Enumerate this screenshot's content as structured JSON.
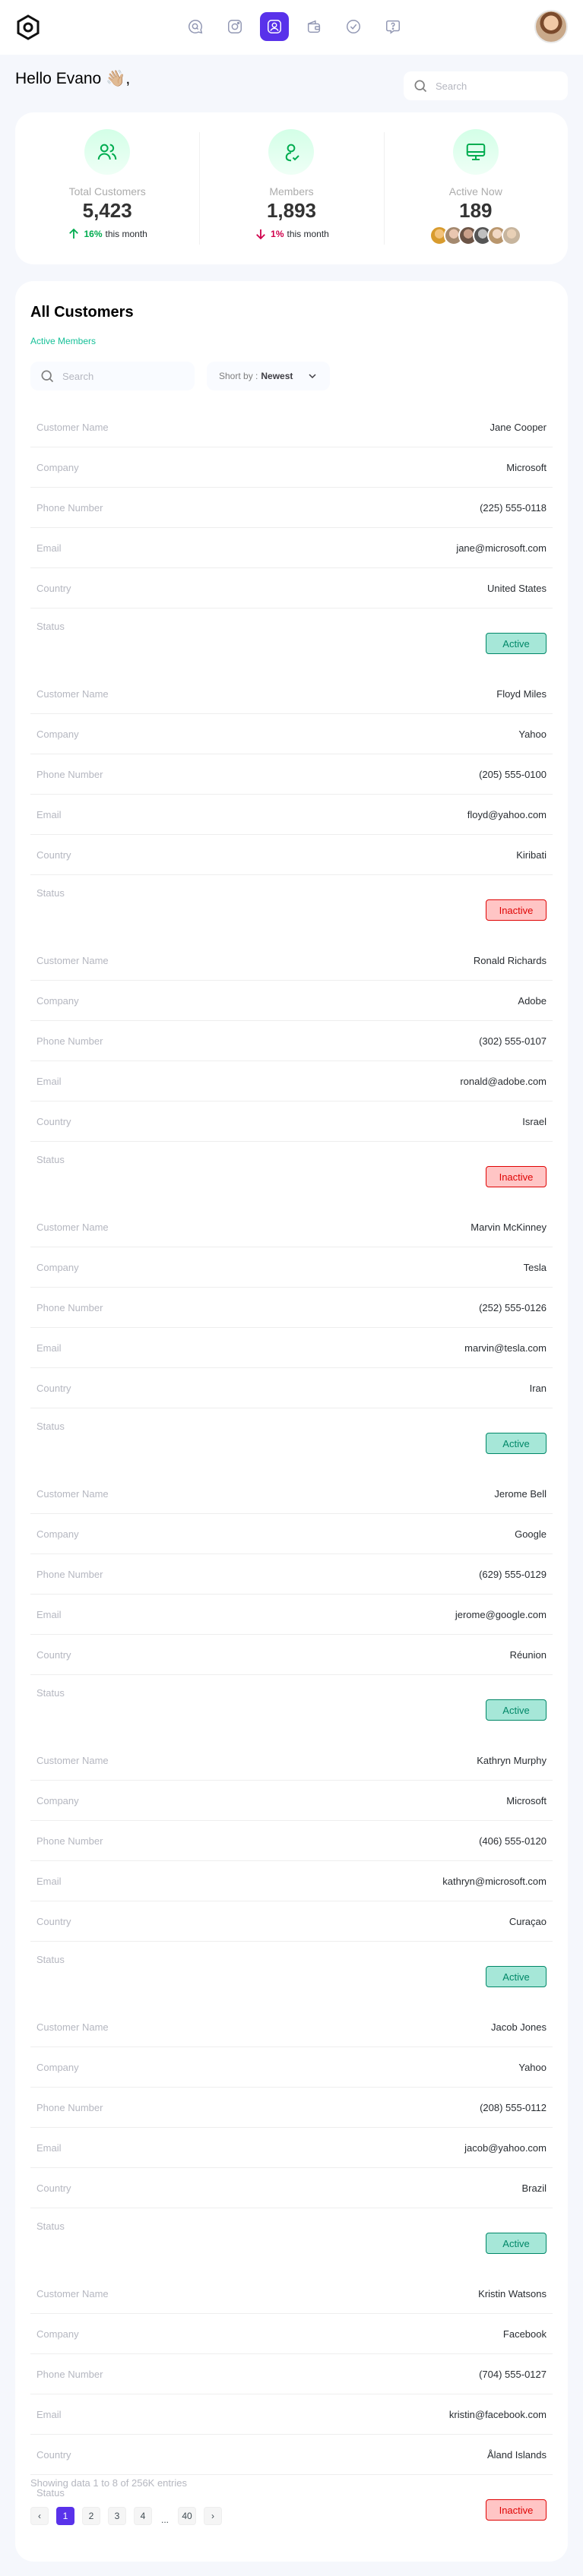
{
  "nav": {
    "items": [
      {
        "icon": "chat-search-icon",
        "active": false
      },
      {
        "icon": "image-icon",
        "active": false
      },
      {
        "icon": "user-profile-icon",
        "active": true
      },
      {
        "icon": "wallet-icon",
        "active": false
      },
      {
        "icon": "badge-check-icon",
        "active": false
      },
      {
        "icon": "message-help-icon",
        "active": false
      }
    ]
  },
  "header": {
    "greeting": "Hello Evano",
    "greeting_suffix": ",",
    "greeting_emoji": "👋🏼",
    "search_placeholder": "Search"
  },
  "stats": [
    {
      "label": "Total Customers",
      "value": "5,423",
      "change_value": "16%",
      "change_text": "this month",
      "direction": "up"
    },
    {
      "label": "Members",
      "value": "1,893",
      "change_value": "1%",
      "change_text": "this month",
      "direction": "down"
    },
    {
      "label": "Active Now",
      "value": "189"
    }
  ],
  "customers": {
    "title": "All Customers",
    "subtitle": "Active Members",
    "search_placeholder": "Search",
    "sort_label": "Short by :",
    "sort_value": "Newest",
    "field_labels": {
      "name": "Customer Name",
      "company": "Company",
      "phone": "Phone Number",
      "email": "Email",
      "country": "Country",
      "status": "Status"
    },
    "records": [
      {
        "name": "Jane Cooper",
        "company": "Microsoft",
        "phone": "(225) 555-0118",
        "email": "jane@microsoft.com",
        "country": "United States",
        "status": "Active"
      },
      {
        "name": "Floyd Miles",
        "company": "Yahoo",
        "phone": "(205) 555-0100",
        "email": "floyd@yahoo.com",
        "country": "Kiribati",
        "status": "Inactive"
      },
      {
        "name": "Ronald Richards",
        "company": "Adobe",
        "phone": "(302) 555-0107",
        "email": "ronald@adobe.com",
        "country": "Israel",
        "status": "Inactive"
      },
      {
        "name": "Marvin McKinney",
        "company": "Tesla",
        "phone": "(252) 555-0126",
        "email": "marvin@tesla.com",
        "country": "Iran",
        "status": "Active"
      },
      {
        "name": "Jerome Bell",
        "company": "Google",
        "phone": "(629) 555-0129",
        "email": "jerome@google.com",
        "country": "Réunion",
        "status": "Active"
      },
      {
        "name": "Kathryn Murphy",
        "company": "Microsoft",
        "phone": "(406) 555-0120",
        "email": "kathryn@microsoft.com",
        "country": "Curaçao",
        "status": "Active"
      },
      {
        "name": "Jacob Jones",
        "company": "Yahoo",
        "phone": "(208) 555-0112",
        "email": "jacob@yahoo.com",
        "country": "Brazil",
        "status": "Active"
      },
      {
        "name": "Kristin Watsons",
        "company": "Facebook",
        "phone": "(704) 555-0127",
        "email": "kristin@facebook.com",
        "country": "Åland Islands",
        "status": "Inactive"
      }
    ],
    "footer_text": "Showing data 1 to 8 of 256K entries",
    "pagination": {
      "prev": "‹",
      "pages": [
        "1",
        "2",
        "3",
        "4"
      ],
      "ellipsis": "...",
      "last": "40",
      "next": "›",
      "current": "1"
    }
  },
  "colors": {
    "accent": "#5932ea",
    "active_green": "#008767",
    "inactive_red": "#df0404",
    "teal_text": "#16c098"
  }
}
